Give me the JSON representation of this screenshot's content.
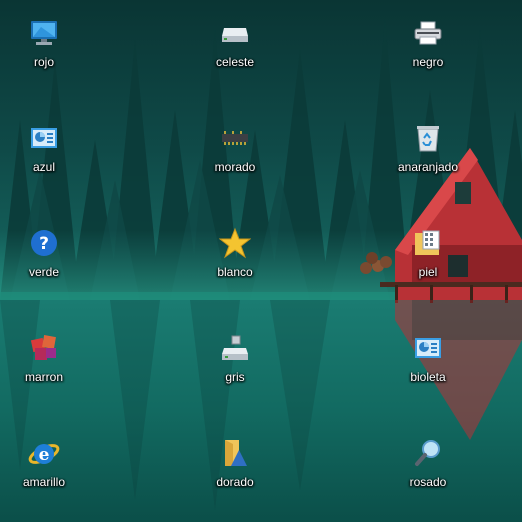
{
  "desktop": {
    "icons": [
      {
        "label": "rojo",
        "icon": "computer-monitor-icon"
      },
      {
        "label": "celeste",
        "icon": "hard-drive-icon"
      },
      {
        "label": "negro",
        "icon": "printer-icon"
      },
      {
        "label": "azul",
        "icon": "control-panel-icon"
      },
      {
        "label": "morado",
        "icon": "memory-chip-icon"
      },
      {
        "label": "anaranjado",
        "icon": "recycle-bin-icon"
      },
      {
        "label": "verde",
        "icon": "help-question-icon"
      },
      {
        "label": "blanco",
        "icon": "star-icon"
      },
      {
        "label": "piel",
        "icon": "folder-grid-icon"
      },
      {
        "label": "marron",
        "icon": "apps-blocks-icon"
      },
      {
        "label": "gris",
        "icon": "usb-drive-icon"
      },
      {
        "label": "bioleta",
        "icon": "control-panel-icon"
      },
      {
        "label": "amarillo",
        "icon": "internet-explorer-icon"
      },
      {
        "label": "dorado",
        "icon": "shared-folder-icon"
      },
      {
        "label": "rosado",
        "icon": "magnifier-search-icon"
      }
    ]
  },
  "colors": {
    "sky": "#0e4d4c",
    "water": "#137168",
    "cabin_red": "#c0353a",
    "label_text": "#ffffff"
  }
}
